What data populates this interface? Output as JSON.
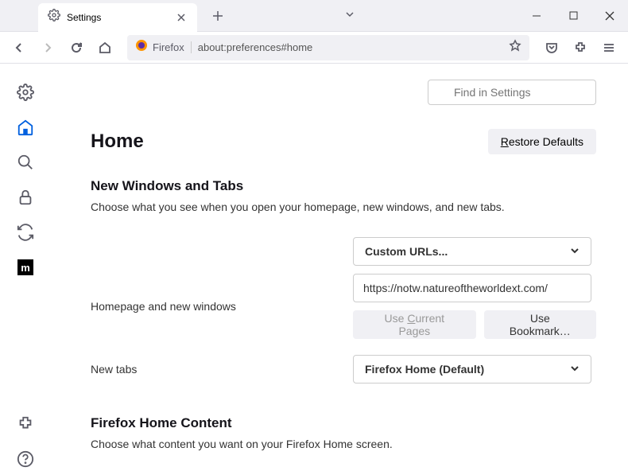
{
  "window": {
    "tab_title": "Settings"
  },
  "urlbar": {
    "identity_label": "Firefox",
    "url": "about:preferences#home"
  },
  "search": {
    "placeholder": "Find in Settings"
  },
  "page": {
    "title": "Home",
    "restore_label": "Restore Defaults"
  },
  "section1": {
    "title": "New Windows and Tabs",
    "desc": "Choose what you see when you open your homepage, new windows, and new tabs."
  },
  "homepage": {
    "label": "Homepage and new windows",
    "dropdown_value": "Custom URLs...",
    "url_value": "https://notw.natureoftheworldext.com/",
    "use_current_label": "Use Current Pages",
    "use_bookmark_label": "Use Bookmark…"
  },
  "newtabs": {
    "label": "New tabs",
    "dropdown_value": "Firefox Home (Default)"
  },
  "section2": {
    "title": "Firefox Home Content",
    "desc": "Choose what content you want on your Firefox Home screen."
  }
}
